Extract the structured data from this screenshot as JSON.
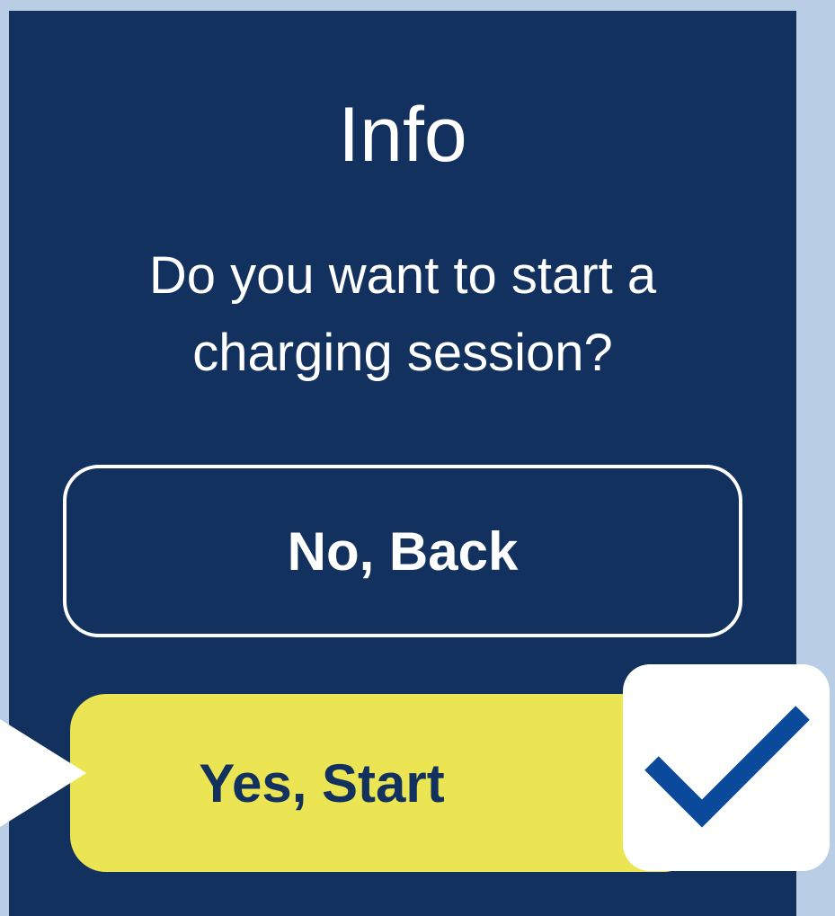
{
  "dialog": {
    "title": "Info",
    "message": "Do you want to start a charging session?"
  },
  "buttons": {
    "back_label": "No, Back",
    "start_label": "Yes, Start"
  },
  "icons": {
    "checkmark": "check-icon",
    "pointer": "arrow-pointer-icon"
  },
  "colors": {
    "panel_bg": "#13315e",
    "outer_bg": "#b9cde4",
    "start_button": "#ebe554",
    "checkmark": "#0b4a9a"
  }
}
